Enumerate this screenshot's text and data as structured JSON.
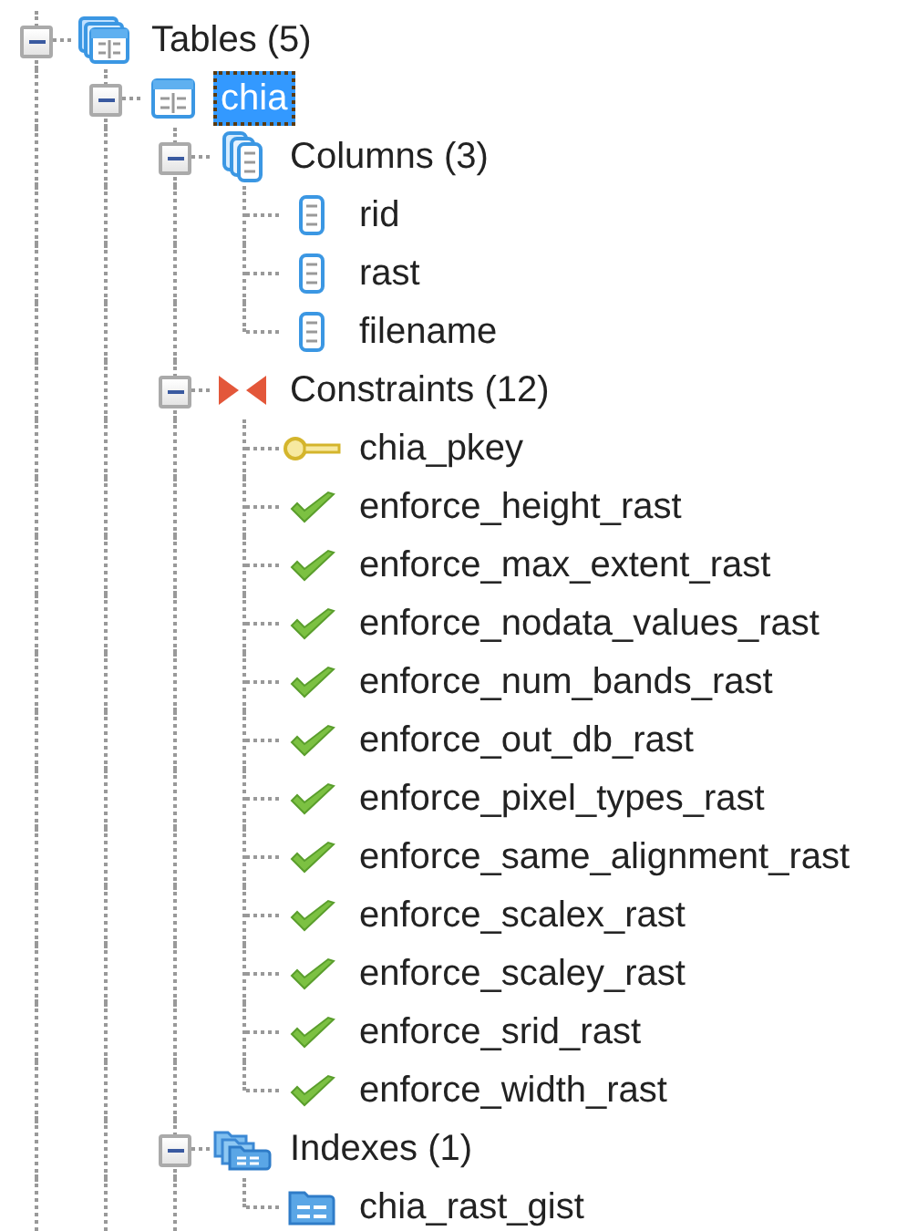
{
  "tree": [
    {
      "kind": "tables",
      "label": "Tables (5)",
      "expanded": true,
      "selected": false,
      "children": [
        {
          "kind": "table",
          "label": "chia",
          "expanded": true,
          "selected": true,
          "children": [
            {
              "kind": "columns",
              "label": "Columns (3)",
              "expanded": true,
              "selected": false,
              "children": [
                {
                  "kind": "column",
                  "label": "rid",
                  "selected": false
                },
                {
                  "kind": "column",
                  "label": "rast",
                  "selected": false
                },
                {
                  "kind": "column",
                  "label": "filename",
                  "selected": false
                }
              ]
            },
            {
              "kind": "constraints",
              "label": "Constraints (12)",
              "expanded": true,
              "selected": false,
              "children": [
                {
                  "kind": "pkey",
                  "label": "chia_pkey",
                  "selected": false
                },
                {
                  "kind": "check",
                  "label": "enforce_height_rast",
                  "selected": false
                },
                {
                  "kind": "check",
                  "label": "enforce_max_extent_rast",
                  "selected": false
                },
                {
                  "kind": "check",
                  "label": "enforce_nodata_values_rast",
                  "selected": false
                },
                {
                  "kind": "check",
                  "label": "enforce_num_bands_rast",
                  "selected": false
                },
                {
                  "kind": "check",
                  "label": "enforce_out_db_rast",
                  "selected": false
                },
                {
                  "kind": "check",
                  "label": "enforce_pixel_types_rast",
                  "selected": false
                },
                {
                  "kind": "check",
                  "label": "enforce_same_alignment_rast",
                  "selected": false
                },
                {
                  "kind": "check",
                  "label": "enforce_scalex_rast",
                  "selected": false
                },
                {
                  "kind": "check",
                  "label": "enforce_scaley_rast",
                  "selected": false
                },
                {
                  "kind": "check",
                  "label": "enforce_srid_rast",
                  "selected": false
                },
                {
                  "kind": "check",
                  "label": "enforce_width_rast",
                  "selected": false
                }
              ]
            },
            {
              "kind": "indexes",
              "label": "Indexes (1)",
              "expanded": true,
              "selected": false,
              "children": [
                {
                  "kind": "index",
                  "label": "chia_rast_gist",
                  "selected": false
                }
              ]
            }
          ]
        }
      ]
    }
  ]
}
